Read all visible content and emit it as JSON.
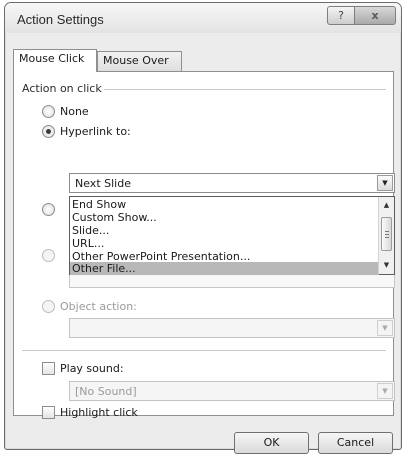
{
  "window": {
    "title": "Action Settings",
    "help_glyph": "?",
    "close_glyph": "x"
  },
  "tabs": [
    {
      "label": "Mouse Click",
      "active": true
    },
    {
      "label": "Mouse Over",
      "active": false
    }
  ],
  "action_group": {
    "label": "Action on click",
    "options": {
      "none": {
        "label": "None",
        "checked": false,
        "enabled": true
      },
      "hyperlink": {
        "label": "Hyperlink to:",
        "checked": true,
        "enabled": true
      },
      "object_action": {
        "label": "Object action:",
        "checked": false,
        "enabled": false
      }
    },
    "hyperlink_value": "Next Slide",
    "dropdown_items": [
      {
        "label": "End Show",
        "selected": false
      },
      {
        "label": "Custom Show...",
        "selected": false
      },
      {
        "label": "Slide...",
        "selected": false
      },
      {
        "label": "URL...",
        "selected": false
      },
      {
        "label": "Other PowerPoint Presentation...",
        "selected": false
      },
      {
        "label": "Other File...",
        "selected": true
      }
    ],
    "object_action_value": ""
  },
  "sound": {
    "label": "Play sound:",
    "checked": false,
    "value": "[No Sound]"
  },
  "highlight": {
    "label": "Highlight click",
    "checked": false
  },
  "buttons": {
    "ok": "OK",
    "cancel": "Cancel"
  },
  "icons": {
    "dropdown_arrow": "▼",
    "scroll_up": "▲",
    "scroll_down": "▼"
  }
}
